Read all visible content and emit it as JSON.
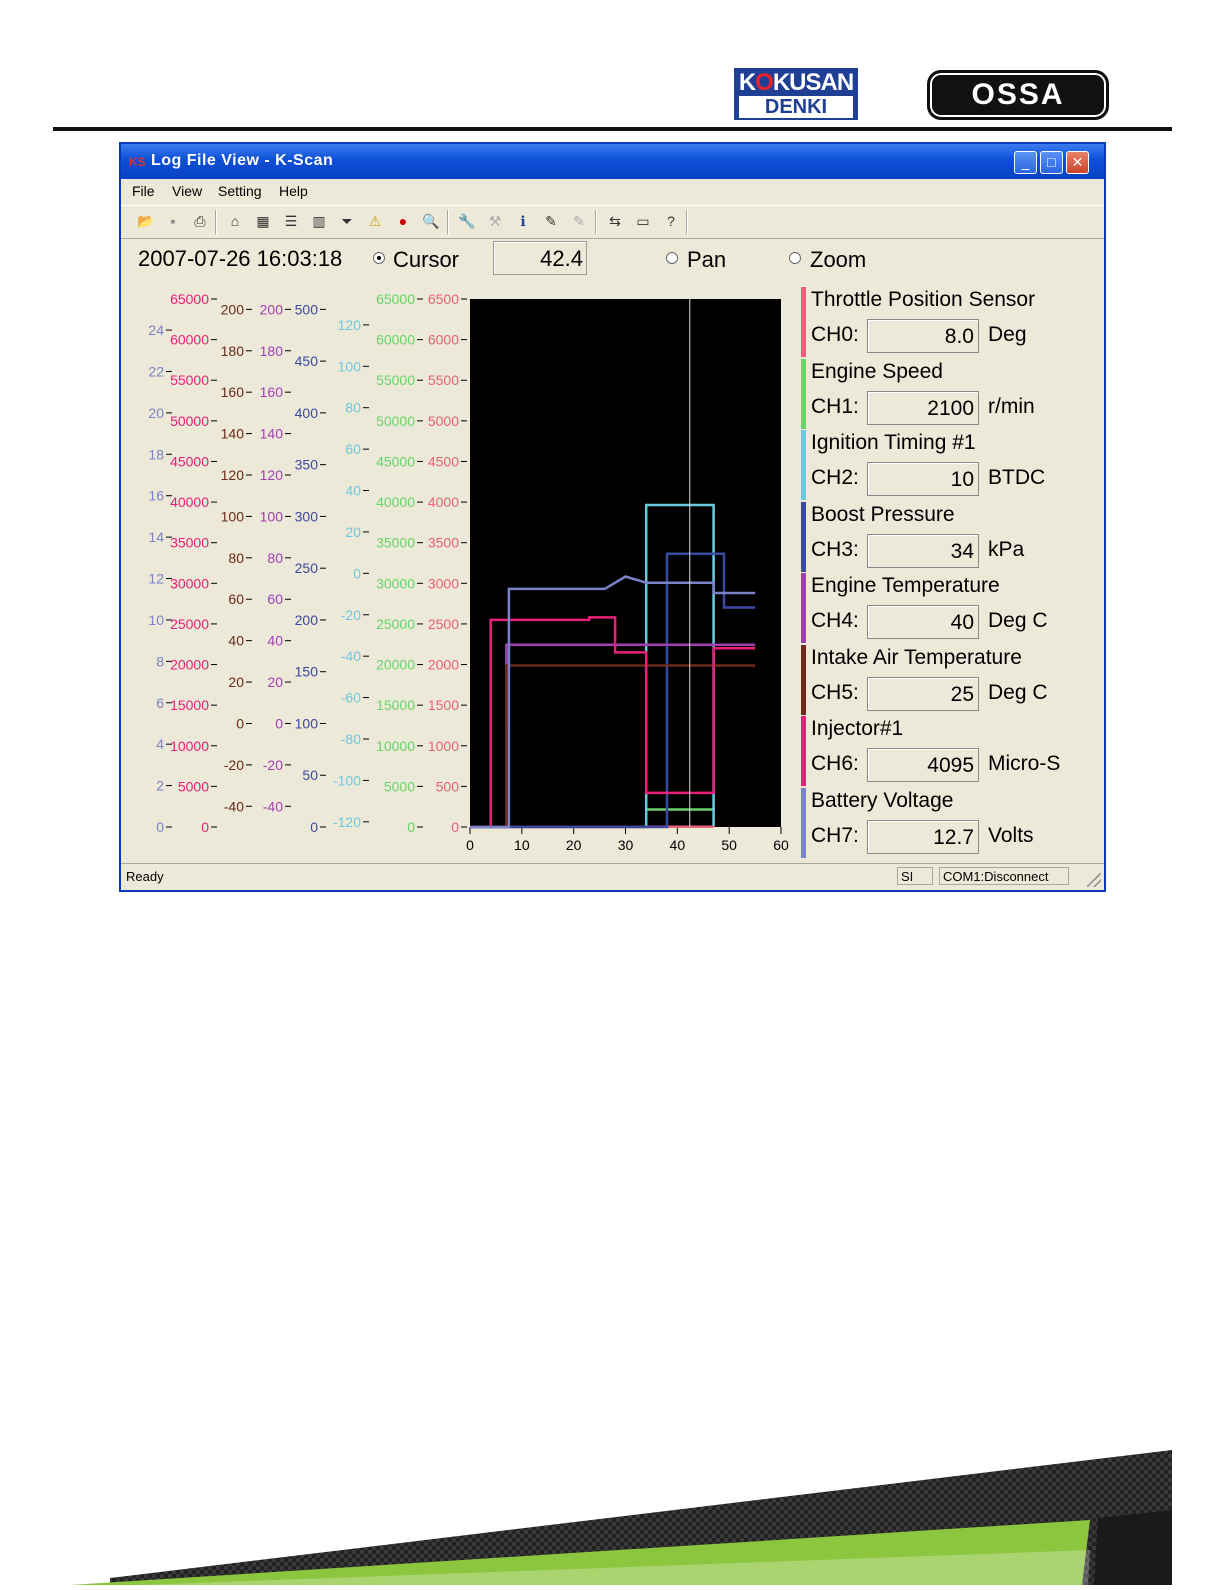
{
  "logos": {
    "kokusan_top_a": "K",
    "kokusan_top_red": "O",
    "kokusan_top_b": "KUSAN",
    "kokusan_bottom": "DENKI",
    "ossa": "OSSA"
  },
  "window": {
    "title": "Log File View - K-Scan",
    "controls": {
      "minimize": "_",
      "maximize": "□",
      "close": "✕"
    }
  },
  "menu": {
    "file": "File",
    "view": "View",
    "setting": "Setting",
    "help": "Help"
  },
  "toolbar_icons": [
    "open-folder-icon",
    "save-icon",
    "print-icon",
    "home-icon",
    "grid-icon",
    "list-icon",
    "bar-chart-icon",
    "filter-icon",
    "warning-icon",
    "record-icon",
    "preview-icon",
    "wrench-icon",
    "tool-disabled-icon",
    "info-icon",
    "version-icon",
    "version-disabled-icon",
    "connect-icon",
    "window-icon",
    "help-icon"
  ],
  "top": {
    "datetime": "2007-07-26 16:03:18",
    "cursor_label": "Cursor",
    "cursor_value": "42.4",
    "pan_label": "Pan",
    "zoom_label": "Zoom",
    "selected_mode": "cursor"
  },
  "channels": [
    {
      "name": "Throttle Position Sensor",
      "label": "CH0:",
      "value": "8.0",
      "unit": "Deg",
      "color": "#e8607a"
    },
    {
      "name": "Engine Speed",
      "label": "CH1:",
      "value": "2100",
      "unit": "r/min",
      "color": "#6ad36a"
    },
    {
      "name": "Ignition Timing #1",
      "label": "CH2:",
      "value": "10",
      "unit": "BTDC",
      "color": "#6cc9df"
    },
    {
      "name": "Boost Pressure",
      "label": "CH3:",
      "value": "34",
      "unit": "kPa",
      "color": "#3a4aa0"
    },
    {
      "name": "Engine Temperature",
      "label": "CH4:",
      "value": "40",
      "unit": "Deg C",
      "color": "#a040b0"
    },
    {
      "name": "Intake Air Temperature",
      "label": "CH5:",
      "value": "25",
      "unit": "Deg C",
      "color": "#6b2a1a"
    },
    {
      "name": "Injector#1",
      "label": "CH6:",
      "value": "4095",
      "unit": "Micro-S",
      "color": "#e8207a"
    },
    {
      "name": "Battery Voltage",
      "label": "CH7:",
      "value": "12.7",
      "unit": "Volts",
      "color": "#7a82c8"
    }
  ],
  "status": {
    "ready": "Ready",
    "units": "SI",
    "port": "COM1:Disconnect"
  },
  "chart_data": {
    "type": "line",
    "xlim": [
      0,
      60
    ],
    "x_ticks": [
      "0",
      "10",
      "20",
      "30",
      "40",
      "50",
      "60"
    ],
    "cursor_x": 42.4,
    "axes": [
      {
        "color": "#7a82c8",
        "ticks": [
          "0",
          "2",
          "4",
          "6",
          "8",
          "10",
          "12",
          "14",
          "16",
          "18",
          "20",
          "22",
          "24"
        ],
        "range": [
          0,
          25.5
        ]
      },
      {
        "color": "#e8207a",
        "ticks": [
          "0",
          "5000",
          "10000",
          "15000",
          "20000",
          "25000",
          "30000",
          "35000",
          "40000",
          "45000",
          "50000",
          "55000",
          "60000",
          "65000"
        ],
        "range": [
          0,
          65000
        ]
      },
      {
        "color": "#6b2a1a",
        "ticks": [
          "-40",
          "-20",
          "0",
          "20",
          "40",
          "60",
          "80",
          "100",
          "120",
          "140",
          "160",
          "180",
          "200"
        ],
        "range": [
          -50,
          205
        ]
      },
      {
        "color": "#a040b0",
        "ticks": [
          "-40",
          "-20",
          "0",
          "20",
          "40",
          "60",
          "80",
          "100",
          "120",
          "140",
          "160",
          "180",
          "200"
        ],
        "range": [
          -50,
          205
        ]
      },
      {
        "color": "#3a4aa0",
        "ticks": [
          "0",
          "50",
          "100",
          "150",
          "200",
          "250",
          "300",
          "350",
          "400",
          "450",
          "500"
        ],
        "range": [
          0,
          510
        ]
      },
      {
        "color": "#6cc9df",
        "ticks": [
          "-120",
          "-100",
          "-80",
          "-60",
          "-40",
          "-20",
          "0",
          "20",
          "40",
          "60",
          "80",
          "100",
          "120"
        ],
        "range": [
          -122.5,
          132.5
        ]
      },
      {
        "color": "#6ad36a",
        "ticks": [
          "0",
          "5000",
          "10000",
          "15000",
          "20000",
          "25000",
          "30000",
          "35000",
          "40000",
          "45000",
          "50000",
          "55000",
          "60000",
          "65000"
        ],
        "range": [
          0,
          65000
        ]
      },
      {
        "color": "#e8607a",
        "ticks": [
          "0",
          "500",
          "1000",
          "1500",
          "2000",
          "2500",
          "3000",
          "3500",
          "4000",
          "4500",
          "5000",
          "5500",
          "6000",
          "6500"
        ],
        "range": [
          0,
          6500
        ]
      }
    ],
    "series": [
      {
        "channel": "CH0",
        "color": "#e8607a",
        "x": [
          0,
          34,
          34,
          47,
          47
        ],
        "y": [
          0,
          0,
          3.9,
          3.9,
          0
        ]
      },
      {
        "channel": "CH1",
        "color": "#6ad36a",
        "x": [
          34,
          34,
          47,
          47
        ],
        "y": [
          2350,
          2150,
          2150,
          2350
        ]
      },
      {
        "channel": "CH2",
        "color": "#6cc9df",
        "x": [
          34,
          34,
          47,
          47
        ],
        "y": [
          -122,
          33,
          33,
          -122
        ]
      },
      {
        "channel": "CH3",
        "color": "#3a4aa0",
        "x": [
          0,
          38,
          38,
          49,
          49,
          55
        ],
        "y": [
          0,
          0,
          264,
          264,
          212,
          212
        ]
      },
      {
        "channel": "CH4",
        "color": "#a040b0",
        "x": [
          7,
          7,
          55
        ],
        "y": [
          0,
          38,
          38
        ]
      },
      {
        "channel": "CH5",
        "color": "#6b2a1a",
        "x": [
          7,
          7,
          55
        ],
        "y": [
          -50,
          28,
          28
        ]
      },
      {
        "channel": "CH6",
        "color": "#e8207a",
        "x": [
          4,
          4,
          23,
          23,
          28,
          28,
          34,
          34,
          47,
          47,
          55
        ],
        "y": [
          0,
          25500,
          25500,
          25800,
          25800,
          21500,
          21500,
          4200,
          4200,
          22000,
          22000
        ]
      },
      {
        "channel": "CH7",
        "color": "#7a82c8",
        "x": [
          0,
          7.5,
          7.5,
          26,
          26,
          30,
          30,
          34,
          34,
          47,
          47,
          55
        ],
        "y": [
          0,
          0,
          11.5,
          11.5,
          11.5,
          12.1,
          12.1,
          11.8,
          11.8,
          11.8,
          11.3,
          11.3
        ]
      }
    ]
  }
}
